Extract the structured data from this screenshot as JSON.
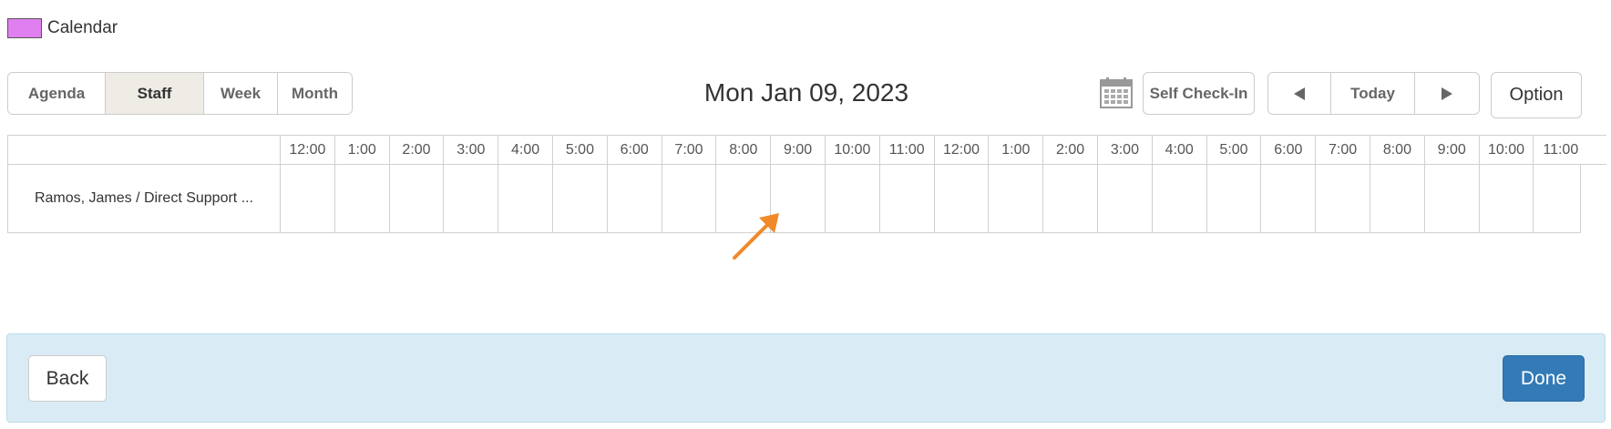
{
  "legend": {
    "label": "Calendar",
    "color": "#e07ff0"
  },
  "view_tabs": [
    {
      "label": "Agenda",
      "active": false
    },
    {
      "label": "Staff",
      "active": true
    },
    {
      "label": "Week",
      "active": false
    },
    {
      "label": "Month",
      "active": false
    }
  ],
  "date_title": "Mon Jan 09, 2023",
  "toolbar": {
    "calendar_icon": "calendar-icon",
    "self_checkin_label": "Self Check-In",
    "prev_icon": "prev-arrow-icon",
    "today_label": "Today",
    "next_icon": "next-arrow-icon",
    "option_label": "Option"
  },
  "schedule": {
    "hours": [
      "12:00",
      "1:00",
      "2:00",
      "3:00",
      "4:00",
      "5:00",
      "6:00",
      "7:00",
      "8:00",
      "9:00",
      "10:00",
      "11:00",
      "12:00",
      "1:00",
      "2:00",
      "3:00",
      "4:00",
      "5:00",
      "6:00",
      "7:00",
      "8:00",
      "9:00",
      "10:00",
      "11:00"
    ],
    "rows": [
      {
        "label": "Ramos, James / Direct Support ..."
      }
    ]
  },
  "annotation": {
    "icon": "pointer-arrow-icon",
    "color": "#f0892a"
  },
  "footer": {
    "back_label": "Back",
    "done_label": "Done",
    "accent": "#337ab7"
  }
}
